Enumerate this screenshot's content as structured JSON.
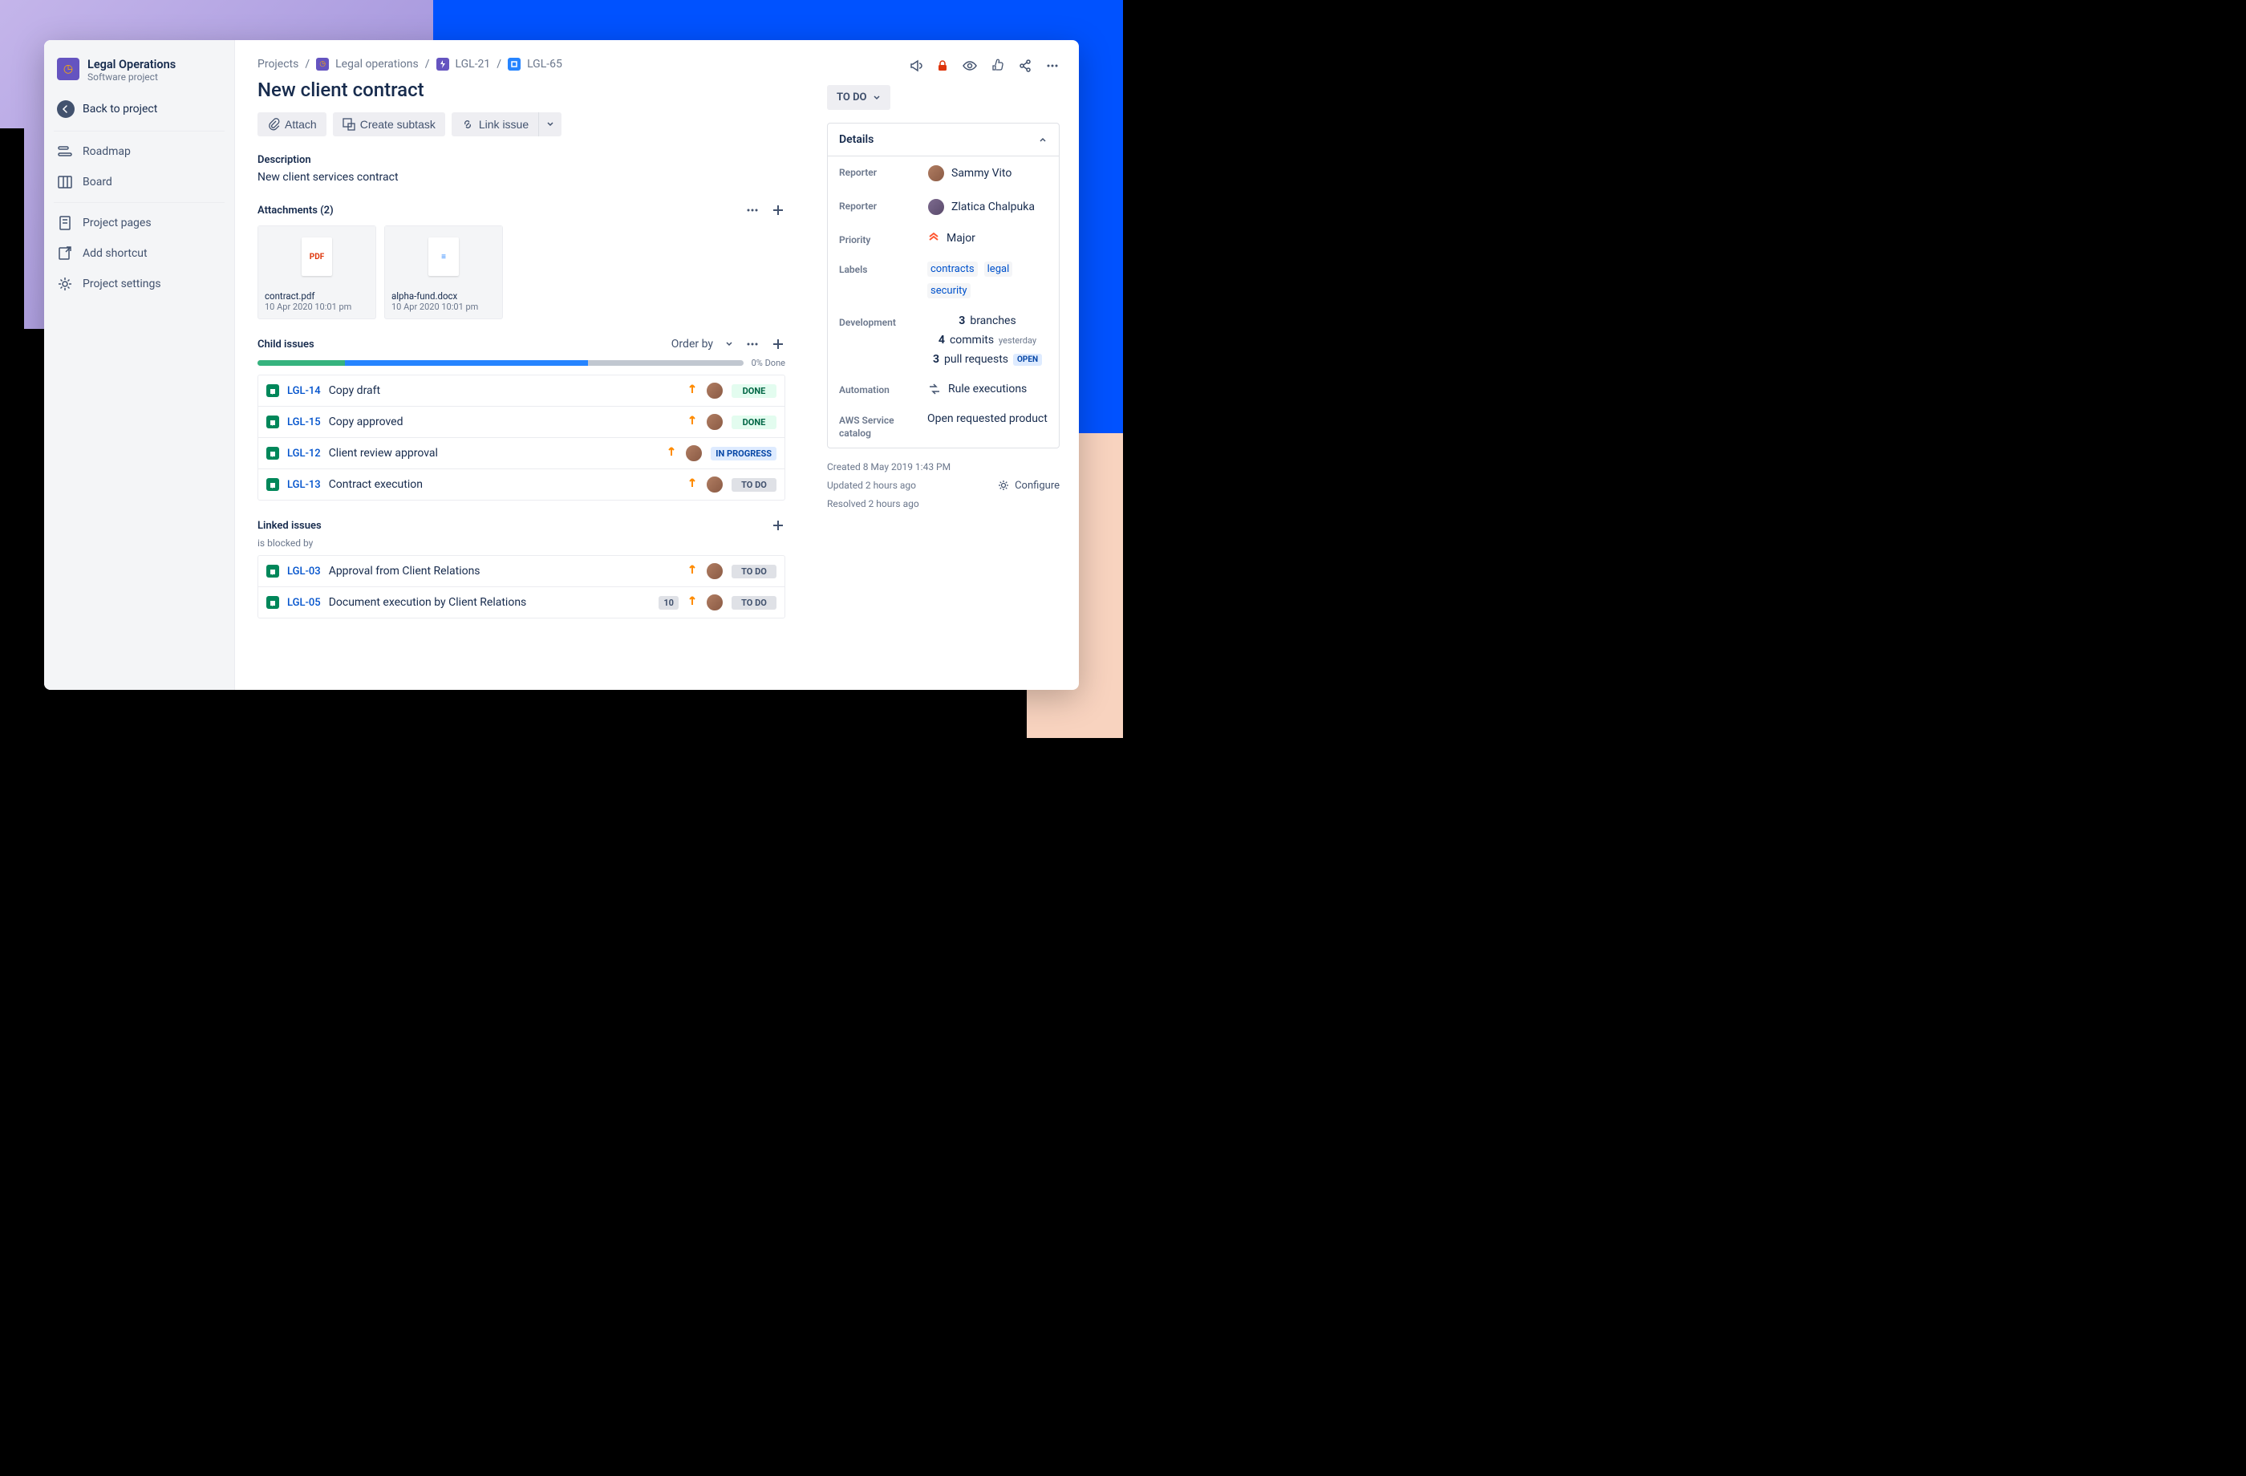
{
  "sidebar": {
    "project_title": "Legal Operations",
    "project_subtitle": "Software project",
    "back_label": "Back to project",
    "nav": [
      {
        "label": "Roadmap"
      },
      {
        "label": "Board"
      }
    ],
    "nav2": [
      {
        "label": "Project pages"
      },
      {
        "label": "Add shortcut"
      },
      {
        "label": "Project settings"
      }
    ]
  },
  "breadcrumb": {
    "root": "Projects",
    "project": "Legal operations",
    "epic": "LGL-21",
    "issue": "LGL-65"
  },
  "issue": {
    "title": "New client contract",
    "actions": {
      "attach": "Attach",
      "subtask": "Create subtask",
      "link": "Link issue"
    },
    "description_label": "Description",
    "description_text": "New client services contract"
  },
  "attachments": {
    "header": "Attachments (2)",
    "items": [
      {
        "name": "contract.pdf",
        "ts": "10 Apr 2020 10:01 pm",
        "badge": "PDF",
        "color": "#DE350B"
      },
      {
        "name": "alpha-fund.docx",
        "ts": "10 Apr 2020 10:01 pm",
        "badge": "≡",
        "color": "#2684FF"
      }
    ]
  },
  "child": {
    "header": "Child issues",
    "orderby": "Order by",
    "percent": "0% Done",
    "progress": {
      "green": 18,
      "blue": 50
    },
    "items": [
      {
        "key": "LGL-14",
        "summary": "Copy draft",
        "status": "DONE",
        "status_cls": "lz-done"
      },
      {
        "key": "LGL-15",
        "summary": "Copy approved",
        "status": "DONE",
        "status_cls": "lz-done"
      },
      {
        "key": "LGL-12",
        "summary": "Client review approval",
        "status": "IN PROGRESS",
        "status_cls": "lz-progress"
      },
      {
        "key": "LGL-13",
        "summary": "Contract execution",
        "status": "TO DO",
        "status_cls": "lz-todo"
      }
    ]
  },
  "linked": {
    "header": "Linked issues",
    "relation": "is blocked by",
    "items": [
      {
        "key": "LGL-03",
        "summary": "Approval from Client Relations",
        "status": "TO DO",
        "status_cls": "lz-todo",
        "count": null
      },
      {
        "key": "LGL-05",
        "summary": "Document execution by Client Relations",
        "status": "TO DO",
        "status_cls": "lz-todo",
        "count": "10"
      }
    ]
  },
  "aside": {
    "status": "TO DO",
    "details_label": "Details",
    "fields": {
      "reporter1": {
        "label": "Reporter",
        "value": "Sammy Vito"
      },
      "reporter2": {
        "label": "Reporter",
        "value": "Zlatica Chalpuka"
      },
      "priority": {
        "label": "Priority",
        "value": "Major"
      },
      "labels": {
        "label": "Labels",
        "values": [
          "contracts",
          "legal",
          "security"
        ]
      },
      "development": {
        "label": "Development",
        "branches_n": "3",
        "branches": "branches",
        "commits_n": "4",
        "commits": "commits",
        "commits_meta": "yesterday",
        "pr_n": "3",
        "pr": "pull requests",
        "pr_badge": "OPEN"
      },
      "automation": {
        "label": "Automation",
        "value": "Rule executions"
      },
      "aws": {
        "label": "AWS Service catalog",
        "value": "Open requested product"
      }
    },
    "meta": {
      "created": "Created 8 May 2019 1:43 PM",
      "updated": "Updated 2 hours ago",
      "resolved": "Resolved 2 hours ago",
      "configure": "Configure"
    }
  }
}
